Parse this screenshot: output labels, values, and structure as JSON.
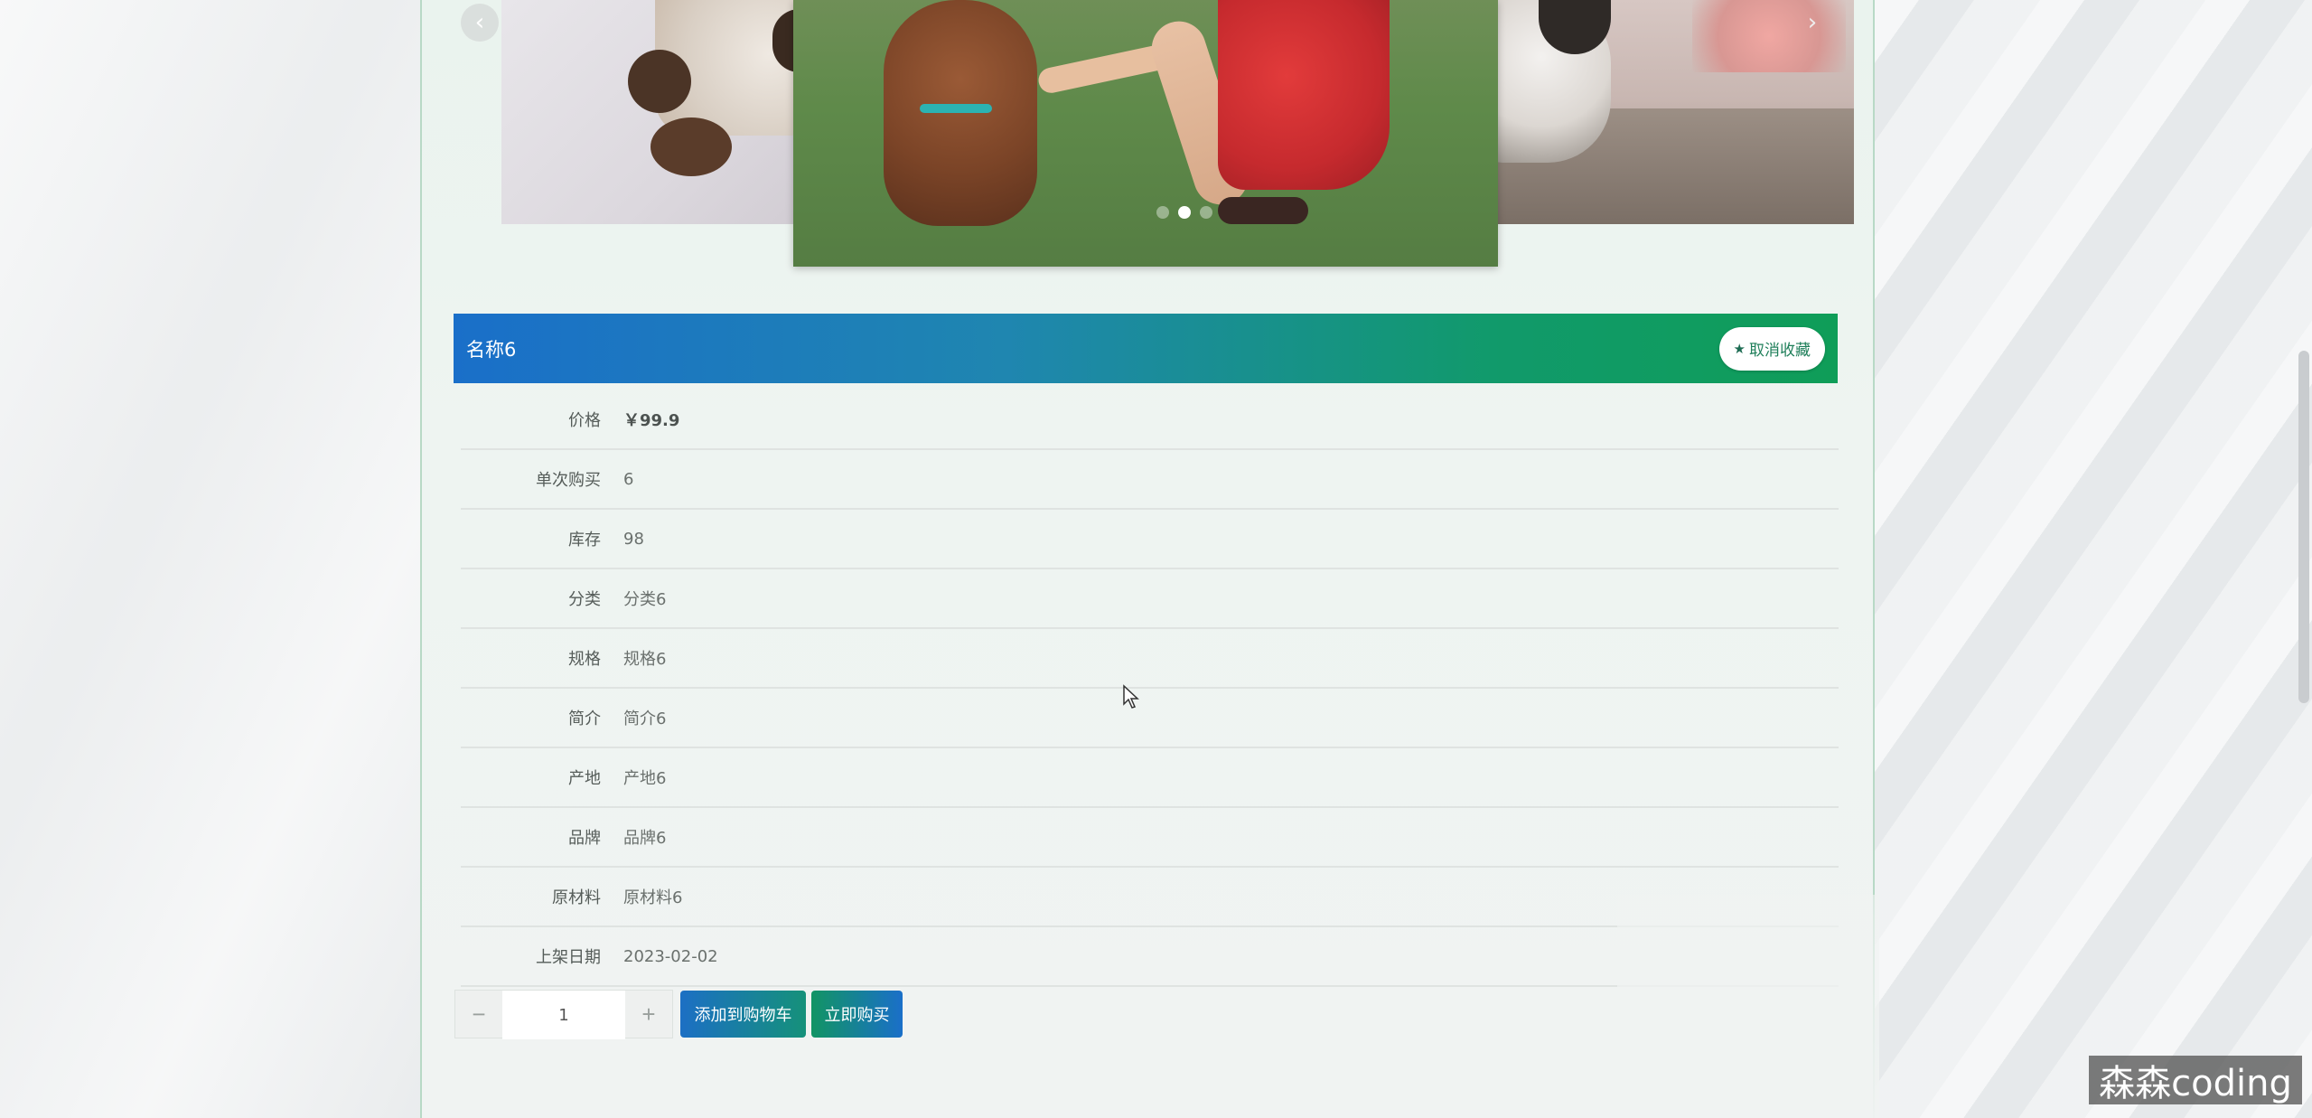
{
  "product": {
    "name": "名称6",
    "favorite_label": "取消收藏"
  },
  "attributes": [
    {
      "label": "价格",
      "value": "￥99.9"
    },
    {
      "label": "单次购买",
      "value": "6"
    },
    {
      "label": "库存",
      "value": "98"
    },
    {
      "label": "分类",
      "value": "分类6"
    },
    {
      "label": "规格",
      "value": "规格6"
    },
    {
      "label": "简介",
      "value": "简介6"
    },
    {
      "label": "产地",
      "value": "产地6"
    },
    {
      "label": "品牌",
      "value": "品牌6"
    },
    {
      "label": "原材料",
      "value": "原材料6"
    },
    {
      "label": "上架日期",
      "value": "2023-02-02"
    }
  ],
  "quantity": {
    "value": "1",
    "minus": "−",
    "plus": "+"
  },
  "actions": {
    "add_to_cart": "添加到购物车",
    "buy_now": "立即购买"
  },
  "carousel": {
    "active_index": 1,
    "dot_count": 3
  },
  "watermark": "森森coding",
  "colors": {
    "title_gradient_start": "#1a6fc9",
    "title_gradient_end": "#0f9d58",
    "favorite_text": "#1f7f5a"
  }
}
